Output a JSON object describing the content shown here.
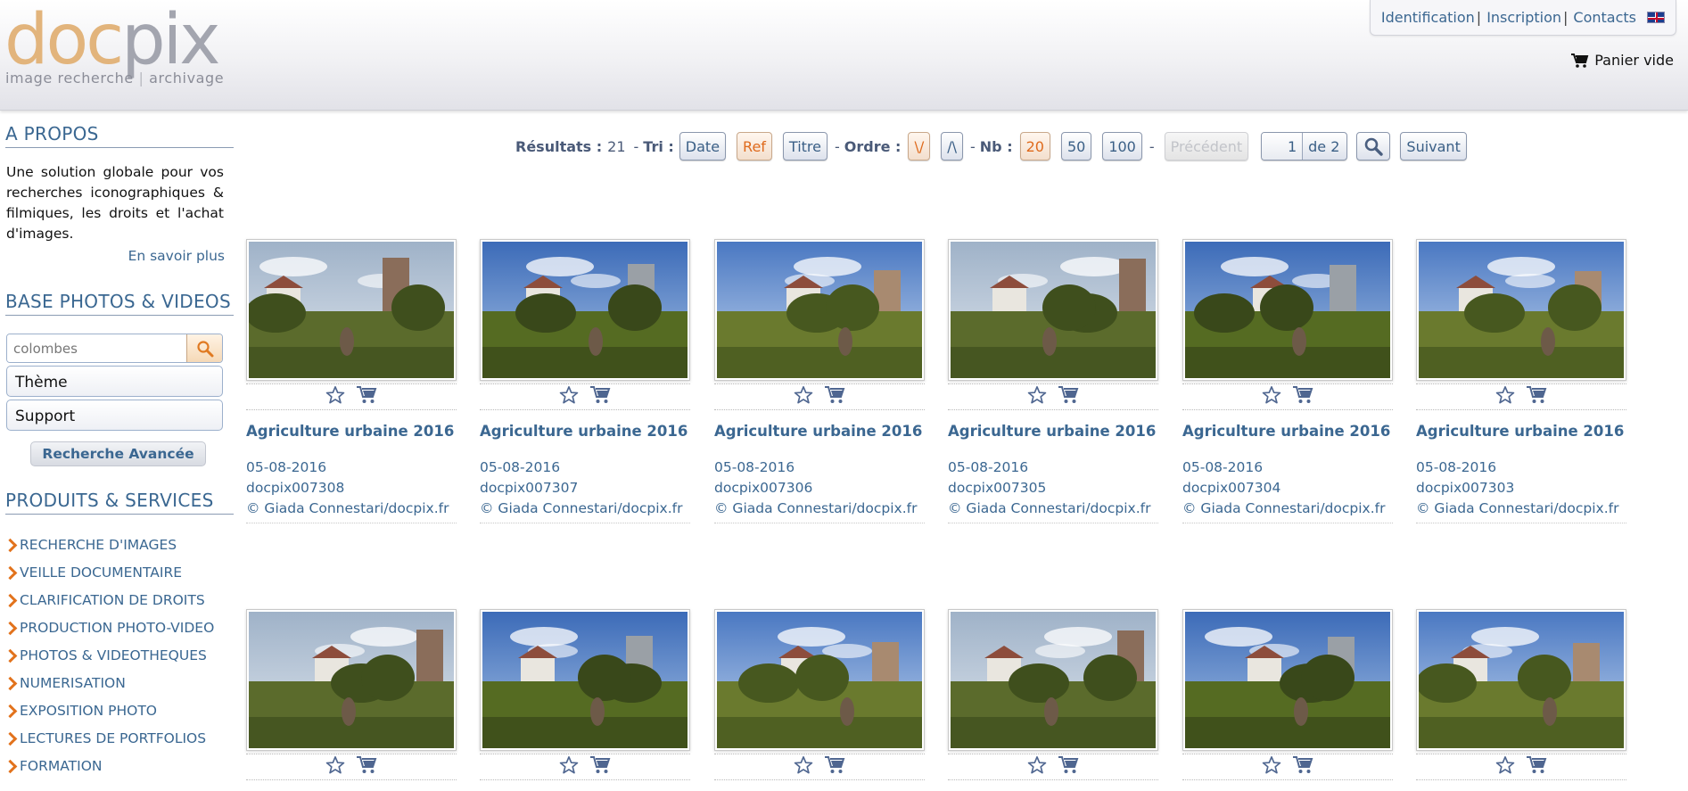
{
  "header": {
    "logo": {
      "word_doc": "doc",
      "word_pix": "pix",
      "tagline_1": "image recherche",
      "tagline_2": "archivage"
    },
    "links": {
      "identification": "Identification",
      "inscription": "Inscription",
      "contacts": "Contacts",
      "separator": "|"
    },
    "cart_label": "Panier vide"
  },
  "sidebar": {
    "about_title": "A PROPOS",
    "about_text": "Une solution globale pour vos recherches iconographiques & filmiques, les droits et l'achat d'images.",
    "more_link": "En savoir plus",
    "base_title": "BASE PHOTOS & VIDEOS",
    "search": {
      "value": "colombes",
      "placeholder": ""
    },
    "theme_label": "Thème",
    "support_label": "Support",
    "advanced_label": "Recherche Avancée",
    "services_title": "PRODUITS & SERVICES",
    "services": [
      "RECHERCHE D'IMAGES",
      "VEILLE DOCUMENTAIRE",
      "CLARIFICATION DE DROITS",
      "PRODUCTION PHOTO-VIDEO",
      "PHOTOS & VIDEOTHEQUES",
      "NUMERISATION",
      "EXPOSITION PHOTO",
      "LECTURES DE PORTFOLIOS",
      "FORMATION"
    ]
  },
  "toolbar": {
    "results_label": "Résultats :",
    "results_count": "21",
    "dash": "-",
    "sort_label": "Tri :",
    "sort_date": "Date",
    "sort_ref": "Ref",
    "sort_title": "Titre",
    "order_label": "Ordre :",
    "order_desc": "\\/",
    "order_asc": "/\\",
    "nb_label": "Nb :",
    "nb_20": "20",
    "nb_50": "50",
    "nb_100": "100",
    "prev": "Précédent",
    "page_current": "1",
    "page_of": "de 2",
    "next": "Suivant"
  },
  "colors": {
    "accent_blue": "#3b6791",
    "accent_orange": "#e2731d",
    "logo_orange": "#e2b47c",
    "logo_grey": "#a3a5af"
  },
  "icons": {
    "cart": "cart-icon",
    "star": "star-icon",
    "search": "search-icon",
    "flag": "uk-flag-icon"
  },
  "results": [
    {
      "title": "Agriculture urbaine 2016",
      "date": "05-08-2016",
      "ref": "docpix007308",
      "credit": "© Giada Connestari/docpix.fr"
    },
    {
      "title": "Agriculture urbaine 2016",
      "date": "05-08-2016",
      "ref": "docpix007307",
      "credit": "© Giada Connestari/docpix.fr"
    },
    {
      "title": "Agriculture urbaine 2016",
      "date": "05-08-2016",
      "ref": "docpix007306",
      "credit": "© Giada Connestari/docpix.fr"
    },
    {
      "title": "Agriculture urbaine 2016",
      "date": "05-08-2016",
      "ref": "docpix007305",
      "credit": "© Giada Connestari/docpix.fr"
    },
    {
      "title": "Agriculture urbaine 2016",
      "date": "05-08-2016",
      "ref": "docpix007304",
      "credit": "© Giada Connestari/docpix.fr"
    },
    {
      "title": "Agriculture urbaine 2016",
      "date": "05-08-2016",
      "ref": "docpix007303",
      "credit": "© Giada Connestari/docpix.fr"
    },
    {
      "title": "",
      "date": "",
      "ref": "",
      "credit": ""
    },
    {
      "title": "",
      "date": "",
      "ref": "",
      "credit": ""
    },
    {
      "title": "",
      "date": "",
      "ref": "",
      "credit": ""
    },
    {
      "title": "",
      "date": "",
      "ref": "",
      "credit": ""
    },
    {
      "title": "",
      "date": "",
      "ref": "",
      "credit": ""
    },
    {
      "title": "",
      "date": "",
      "ref": "",
      "credit": ""
    }
  ]
}
